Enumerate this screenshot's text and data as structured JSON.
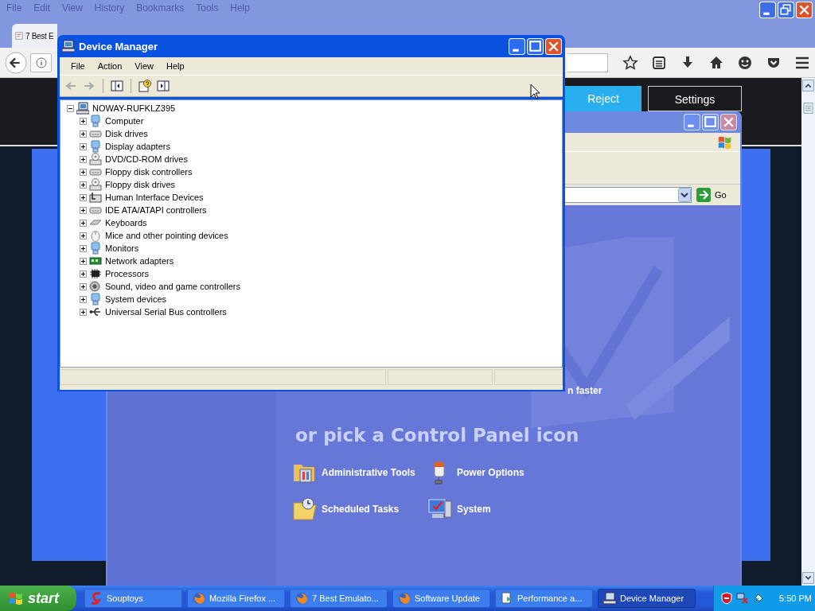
{
  "browser": {
    "menu": [
      "File",
      "Edit",
      "View",
      "History",
      "Bookmarks",
      "Tools",
      "Help"
    ],
    "tab": {
      "title": "7 Best E"
    },
    "page": {
      "buttons": [
        {
          "label": "Reject",
          "kind": "filled"
        },
        {
          "label": "Settings",
          "kind": "outline"
        }
      ]
    }
  },
  "control_panel": {
    "go": "Go",
    "task_text": "n faster",
    "heading": "or pick a Control Panel icon",
    "icons": [
      {
        "label": "Administrative Tools",
        "kind": "admin"
      },
      {
        "label": "Power Options",
        "kind": "power"
      },
      {
        "label": "Scheduled Tasks",
        "kind": "tasks"
      },
      {
        "label": "System",
        "kind": "system"
      }
    ]
  },
  "device_manager": {
    "title": "Device Manager",
    "menu": [
      "File",
      "Action",
      "View",
      "Help"
    ],
    "tree": {
      "label": "NOWAY-RUFKLZ395",
      "expanded": true,
      "children": [
        {
          "label": "Computer",
          "kind": "monitor",
          "expanded": false
        },
        {
          "label": "Disk drives",
          "kind": "drive",
          "expanded": false
        },
        {
          "label": "Display adapters",
          "kind": "monitor",
          "expanded": false
        },
        {
          "label": "DVD/CD-ROM drives",
          "kind": "cd",
          "expanded": false
        },
        {
          "label": "Floppy disk controllers",
          "kind": "drive",
          "expanded": false
        },
        {
          "label": "Floppy disk drives",
          "kind": "cd",
          "expanded": false
        },
        {
          "label": "Human Interface Devices",
          "kind": "hid",
          "expanded": false
        },
        {
          "label": "IDE ATA/ATAPI controllers",
          "kind": "drive",
          "expanded": false
        },
        {
          "label": "Keyboards",
          "kind": "keyboard",
          "expanded": false
        },
        {
          "label": "Mice and other pointing devices",
          "kind": "mouse",
          "expanded": false
        },
        {
          "label": "Monitors",
          "kind": "monitor",
          "expanded": false
        },
        {
          "label": "Network adapters",
          "kind": "network",
          "expanded": false
        },
        {
          "label": "Processors",
          "kind": "chip",
          "expanded": false
        },
        {
          "label": "Sound, video and game controllers",
          "kind": "sound",
          "expanded": false
        },
        {
          "label": "System devices",
          "kind": "monitor",
          "expanded": false
        },
        {
          "label": "Universal Serial Bus controllers",
          "kind": "usb",
          "expanded": false
        }
      ]
    }
  },
  "taskbar": {
    "start": "start",
    "items": [
      {
        "label": "Souptoys",
        "kind": "souptoys",
        "selected": false
      },
      {
        "label": "Mozilla Firefox ...",
        "kind": "firefox",
        "selected": false
      },
      {
        "label": "7 Best Emulato...",
        "kind": "firefox",
        "selected": false
      },
      {
        "label": "Software Update",
        "kind": "firefox",
        "selected": false
      },
      {
        "label": "Performance a...",
        "kind": "document",
        "selected": false
      },
      {
        "label": "Device Manager",
        "kind": "computer",
        "selected": true
      }
    ],
    "clock": "5:50 PM"
  }
}
